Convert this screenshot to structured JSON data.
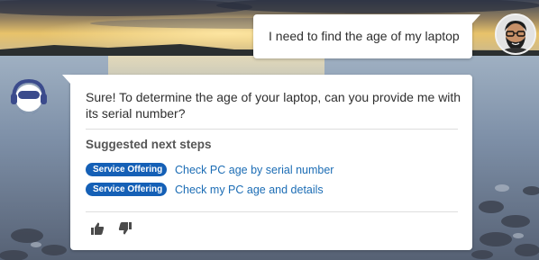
{
  "conversation": {
    "user_message": "I need to find the age of my laptop",
    "bot_message": "Sure! To determine the age of your laptop, can you provide me with its serial number?",
    "suggested_heading": "Suggested next steps",
    "suggestions": [
      {
        "badge": "Service Offering",
        "link": "Check PC age by serial number"
      },
      {
        "badge": "Service Offering",
        "link": "Check my PC age and details"
      }
    ]
  },
  "icons": {
    "user_avatar": "user-avatar-illustration",
    "bot_avatar": "virtual-agent-avatar",
    "thumbs_up": "thumbs-up-icon",
    "thumbs_down": "thumbs-down-icon"
  },
  "colors": {
    "badge": "#1560b6",
    "link": "#1c6db5",
    "bot_avatar_primary": "#3b4b8c"
  }
}
